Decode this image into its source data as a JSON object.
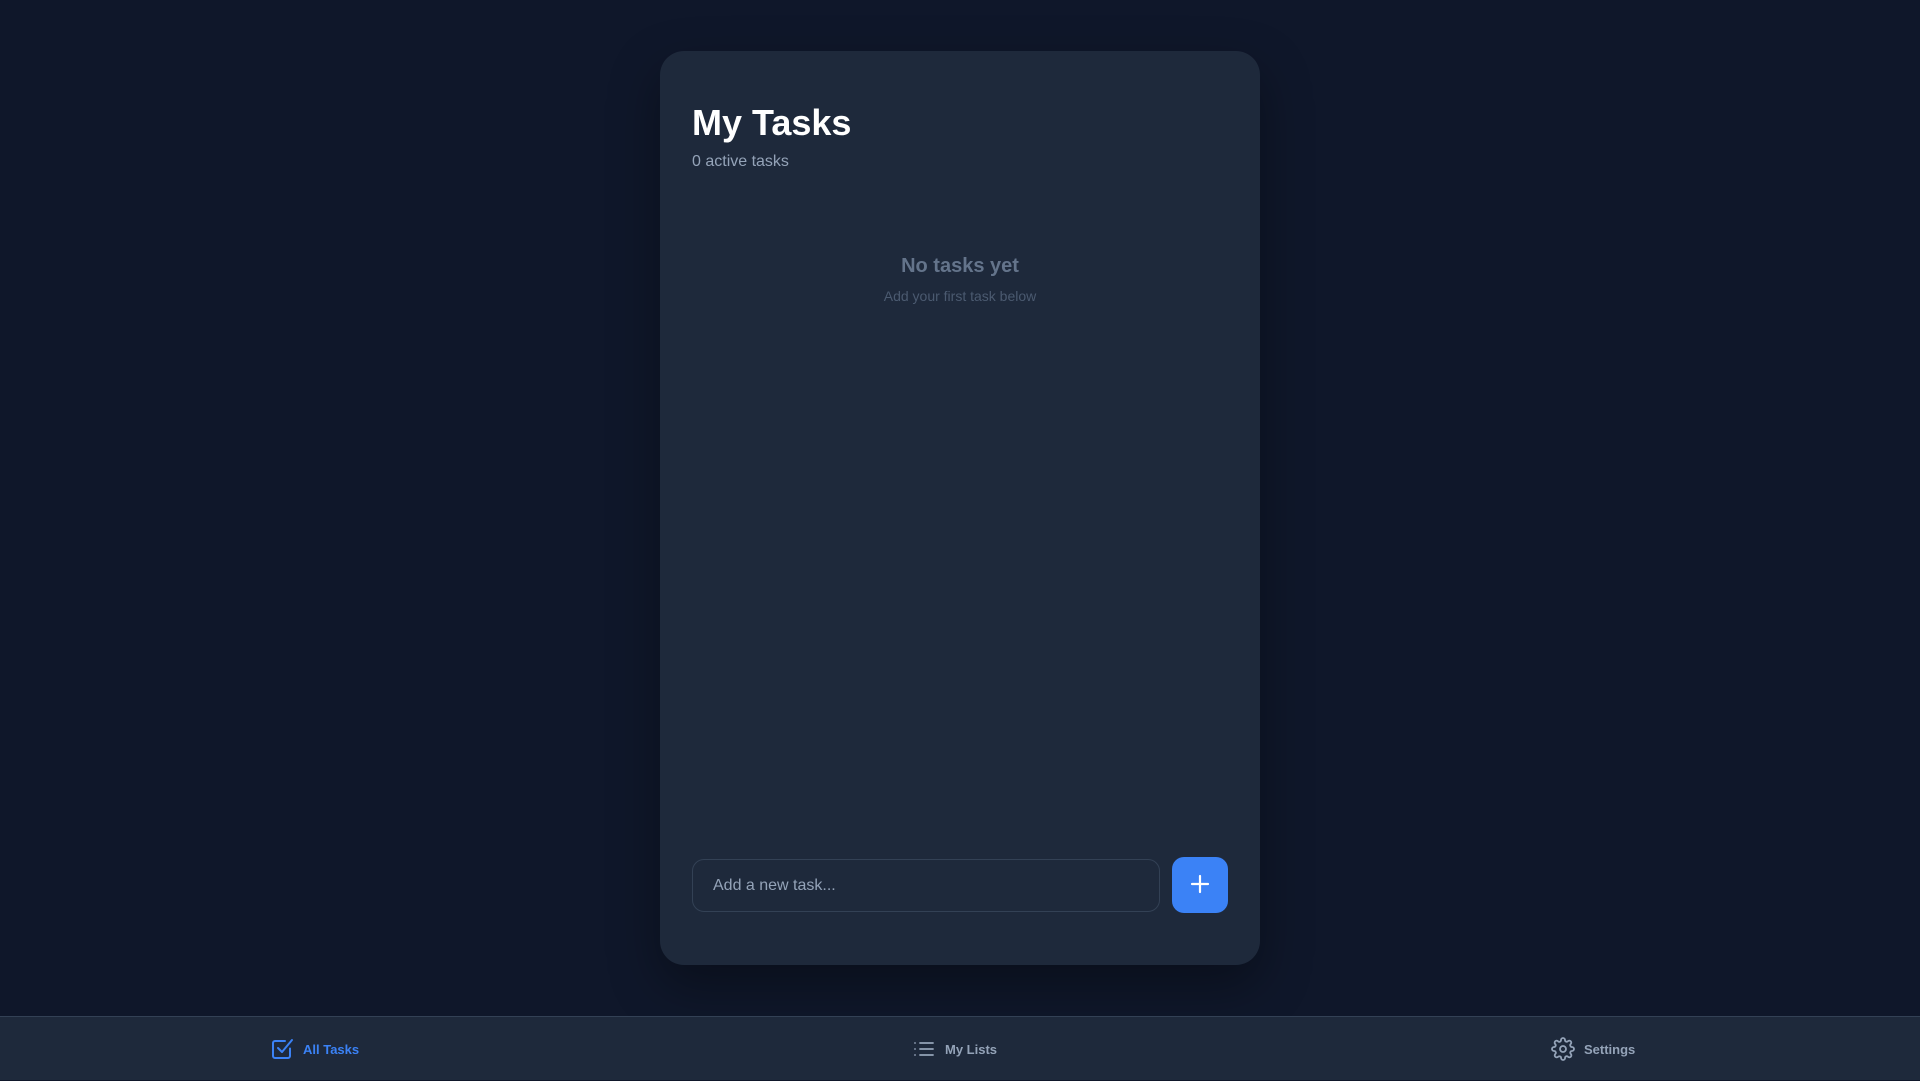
{
  "header": {
    "title": "My Tasks",
    "subtitle": "0 active tasks"
  },
  "empty_state": {
    "title": "No tasks yet",
    "subtitle": "Add your first task below"
  },
  "new_task": {
    "value": "",
    "placeholder": "Add a new task...",
    "add_button_icon": "plus-icon"
  },
  "bottom_nav": {
    "items": [
      {
        "label": "All Tasks",
        "icon": "checkbox-icon",
        "active": true
      },
      {
        "label": "My Lists",
        "icon": "list-icon",
        "active": false
      },
      {
        "label": "Settings",
        "icon": "gear-icon",
        "active": false
      }
    ]
  },
  "colors": {
    "background": "#0f172a",
    "card": "#1e293b",
    "accent": "#3b82f6",
    "muted_text": "#94a3b8"
  }
}
